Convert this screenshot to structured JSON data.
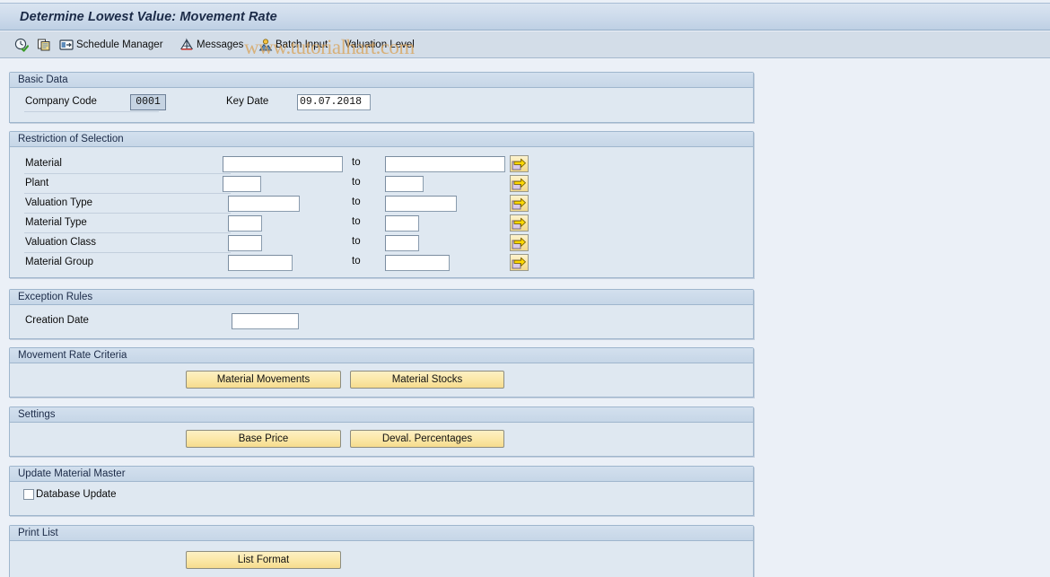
{
  "window": {
    "title": "Determine Lowest Value: Movement Rate"
  },
  "watermark": "www.tutorialhart.com",
  "toolbar": {
    "items": [
      {
        "icon": "execute-clock-icon",
        "label": ""
      },
      {
        "icon": "copy-variant-icon",
        "label": ""
      },
      {
        "icon": "schedule-manager-icon",
        "label": "Schedule Manager"
      },
      {
        "icon": "messages-icon",
        "label": "Messages"
      },
      {
        "icon": "batch-input-icon",
        "label": "Batch Input"
      },
      {
        "icon": "valuation-level-icon",
        "label": "Valuation Level"
      }
    ]
  },
  "sections": {
    "basic_data": {
      "title": "Basic Data",
      "company_code_label": "Company Code",
      "company_code_value": "0001",
      "key_date_label": "Key Date",
      "key_date_value": "09.07.2018"
    },
    "restriction": {
      "title": "Restriction of Selection",
      "to_label": "to",
      "rows": [
        {
          "label": "Material",
          "from": "",
          "to": ""
        },
        {
          "label": "Plant",
          "from": "",
          "to": ""
        },
        {
          "label": "Valuation Type",
          "from": "",
          "to": ""
        },
        {
          "label": "Material Type",
          "from": "",
          "to": ""
        },
        {
          "label": "Valuation Class",
          "from": "",
          "to": ""
        },
        {
          "label": "Material Group",
          "from": "",
          "to": ""
        }
      ],
      "multi_select_tooltip": "Multiple selection"
    },
    "exception_rules": {
      "title": "Exception Rules",
      "creation_date_label": "Creation Date",
      "creation_date_value": ""
    },
    "movement_rate_criteria": {
      "title": "Movement Rate Criteria",
      "button_material_movements": "Material Movements",
      "button_material_stocks": "Material Stocks"
    },
    "settings": {
      "title": "Settings",
      "button_base_price": "Base Price",
      "button_deval_percentages": "Deval. Percentages"
    },
    "update_material_master": {
      "title": "Update Material Master",
      "database_update_label": "Database Update",
      "database_update_checked": false
    },
    "print_list": {
      "title": "Print List",
      "button_list_format": "List Format"
    }
  },
  "colors": {
    "title_bar": "#cfdcec",
    "toolbar": "#d3dde8",
    "group_header": "#c6d6e7",
    "group_body": "#dfe8f1",
    "button_yellow": "#fbe8a8",
    "page_background": "#ebf0f7",
    "focused_field": "#c5d3e2",
    "watermark": "#d9a45c"
  }
}
